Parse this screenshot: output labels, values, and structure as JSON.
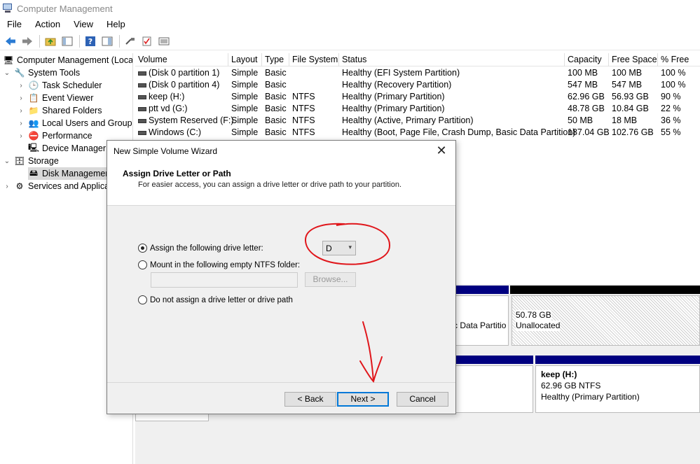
{
  "window": {
    "title": "Computer Management"
  },
  "menu": [
    "File",
    "Action",
    "View",
    "Help"
  ],
  "tree": {
    "root": "Computer Management (Local",
    "system_tools": "System Tools",
    "task_scheduler": "Task Scheduler",
    "event_viewer": "Event Viewer",
    "shared_folders": "Shared Folders",
    "local_users": "Local Users and Groups",
    "performance": "Performance",
    "device_manager": "Device Manager",
    "storage": "Storage",
    "disk_management": "Disk Management",
    "services": "Services and Applica"
  },
  "table": {
    "columns": [
      "Volume",
      "Layout",
      "Type",
      "File System",
      "Status",
      "Capacity",
      "Free Space",
      "% Free"
    ],
    "rows": [
      [
        "(Disk 0 partition 1)",
        "Simple",
        "Basic",
        "",
        "Healthy (EFI System Partition)",
        "100 MB",
        "100 MB",
        "100 %"
      ],
      [
        "(Disk 0 partition 4)",
        "Simple",
        "Basic",
        "",
        "Healthy (Recovery Partition)",
        "547 MB",
        "547 MB",
        "100 %"
      ],
      [
        "keep (H:)",
        "Simple",
        "Basic",
        "NTFS",
        "Healthy (Primary Partition)",
        "62.96 GB",
        "56.93 GB",
        "90 %"
      ],
      [
        "ptt vd (G:)",
        "Simple",
        "Basic",
        "NTFS",
        "Healthy (Primary Partition)",
        "48.78 GB",
        "10.84 GB",
        "22 %"
      ],
      [
        "System Reserved (F:)",
        "Simple",
        "Basic",
        "NTFS",
        "Healthy (Active, Primary Partition)",
        "50 MB",
        "18 MB",
        "36 %"
      ],
      [
        "Windows (C:)",
        "Simple",
        "Basic",
        "NTFS",
        "Healthy (Boot, Page File, Crash Dump, Basic Data Partition)",
        "187.04 GB",
        "102.76 GB",
        "55 %"
      ]
    ]
  },
  "disk_view": {
    "partition_fragment": "c Data Partitio",
    "unallocated_size": "50.78 GB",
    "unallocated_label": "Unallocated",
    "keep_name": "keep  (H:)",
    "keep_size": "62.96 GB NTFS",
    "keep_status": "Healthy (Primary Partition)"
  },
  "dialog": {
    "title": "New Simple Volume Wizard",
    "heading": "Assign Drive Letter or Path",
    "subheading": "For easier access, you can assign a drive letter or drive path to your partition.",
    "option_assign": "Assign the following drive letter:",
    "option_mount": "Mount in the following empty NTFS folder:",
    "option_none": "Do not assign a drive letter or drive path",
    "drive_letter": "D",
    "browse": "Browse...",
    "back": "< Back",
    "next": "Next >",
    "cancel": "Cancel"
  },
  "annotation_color": "#e0161b"
}
